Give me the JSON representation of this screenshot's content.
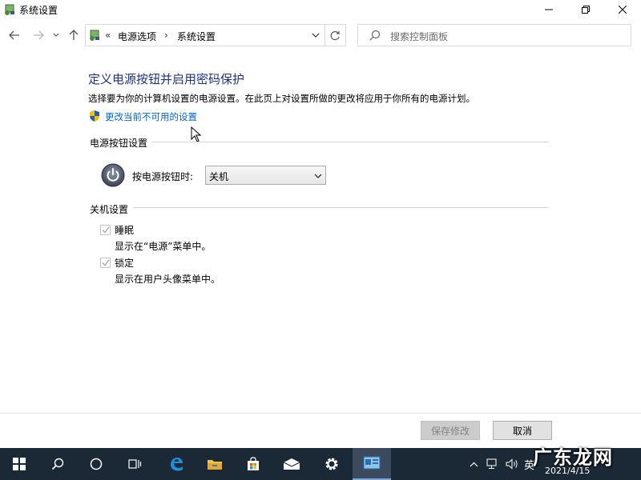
{
  "window": {
    "title": "系统设置",
    "app_icon": "control-panel-icon"
  },
  "navbar": {
    "breadcrumb_prefix": "«",
    "breadcrumbs": [
      "电源选项",
      "系统设置"
    ],
    "search_placeholder": "搜索控制面板"
  },
  "main": {
    "title": "定义电源按钮并启用密码保护",
    "description": "选择要为你的计算机设置的电源设置。在此页上对设置所做的更改将应用于你所有的电源计划。",
    "change_link": "更改当前不可用的设置",
    "power_section": {
      "header": "电源按钮设置",
      "label": "按电源按钮时:",
      "selected": "关机"
    },
    "shutdown_section": {
      "header": "关机设置",
      "options": [
        {
          "label": "睡眠",
          "desc": "显示在“电源”菜单中。",
          "checked": true
        },
        {
          "label": "锁定",
          "desc": "显示在用户头像菜单中。",
          "checked": true
        }
      ]
    }
  },
  "footer": {
    "save_label": "保存修改",
    "cancel_label": "取消"
  },
  "taskbar": {
    "items": [
      "windows-start-icon",
      "search-icon",
      "cortana-icon",
      "task-view-icon",
      "edge-icon",
      "file-explorer-icon",
      "store-icon",
      "mail-icon",
      "settings-icon",
      "control-panel-icon"
    ],
    "lang": "英",
    "date": "2021/4/15"
  },
  "watermark": "广东龙网",
  "colors": {
    "title_blue": "#1e3287",
    "link_blue": "#0066cc",
    "taskbar": "#1b2836"
  }
}
